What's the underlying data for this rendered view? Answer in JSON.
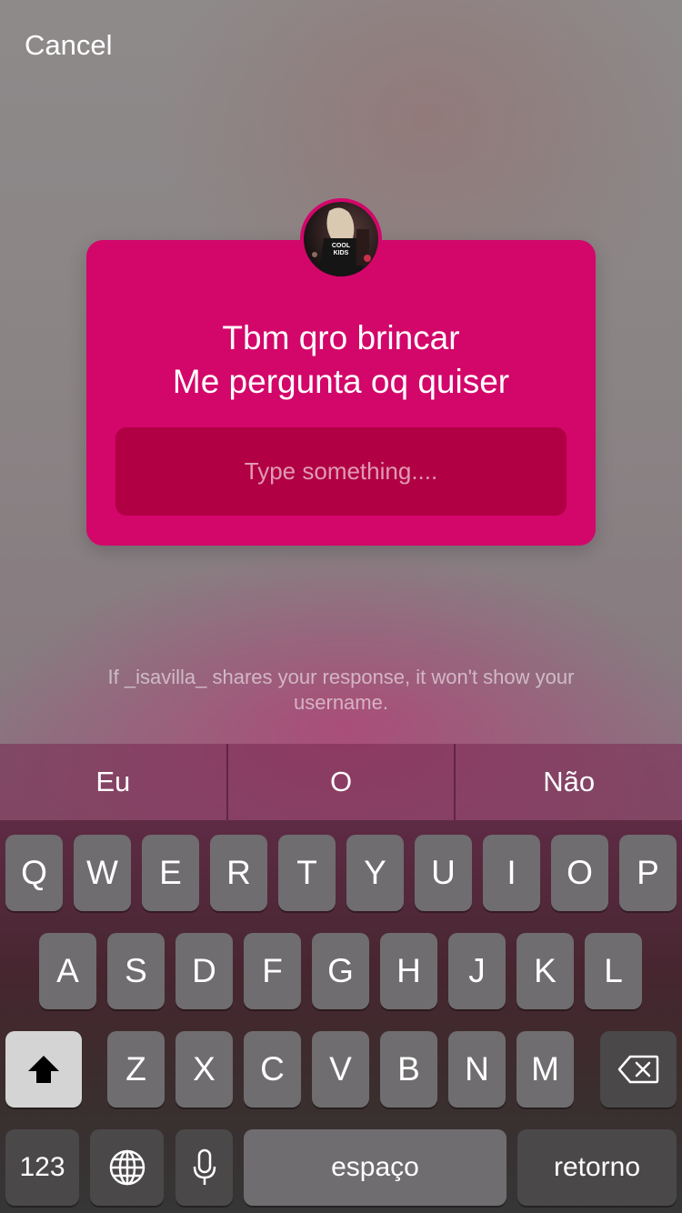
{
  "header": {
    "cancel_label": "Cancel"
  },
  "card": {
    "question_line1": "Tbm qro brincar",
    "question_line2": "Me pergunta oq quiser",
    "answer_placeholder": "Type something....",
    "avatar_shirt_text": "COOL KIDS",
    "color": "#d3066a",
    "input_color": "#b10043"
  },
  "privacy_note": "If _isavilla_ shares your response, it won't show your username.",
  "suggestions": [
    "Eu",
    "O",
    "Não"
  ],
  "keyboard": {
    "row1": [
      "Q",
      "W",
      "E",
      "R",
      "T",
      "Y",
      "U",
      "I",
      "O",
      "P"
    ],
    "row2": [
      "A",
      "S",
      "D",
      "F",
      "G",
      "H",
      "J",
      "K",
      "L"
    ],
    "row3": [
      "Z",
      "X",
      "C",
      "V",
      "B",
      "N",
      "M"
    ],
    "numbers_label": "123",
    "space_label": "espaço",
    "return_label": "retorno",
    "icons": {
      "shift": "shift-arrow-icon",
      "delete": "backspace-icon",
      "globe": "globe-icon",
      "mic": "microphone-icon"
    }
  }
}
